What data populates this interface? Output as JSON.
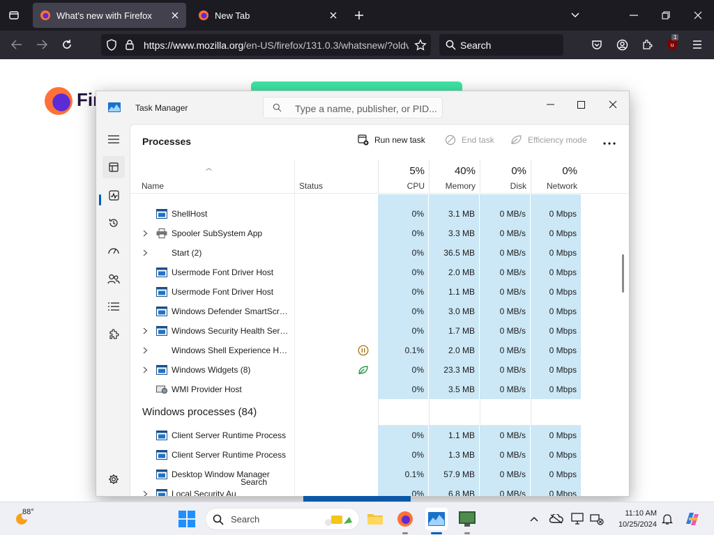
{
  "browser": {
    "tabs": [
      {
        "title": "What's new with Firefox",
        "active": true
      },
      {
        "title": "New Tab",
        "active": false
      }
    ],
    "url_host": "https://www.mozilla.org",
    "url_rest": "/en-US/firefox/131.0.3/whatsnew/?oldv",
    "search_placeholder": "Search",
    "extension_badge": "1",
    "page_brand": "Firef"
  },
  "task_manager": {
    "title": "Task Manager",
    "search_placeholder": "Type a name, publisher, or PID...",
    "page_title": "Processes",
    "actions": {
      "run_new_task": "Run new task",
      "end_task": "End task",
      "efficiency_mode": "Efficiency mode"
    },
    "columns": {
      "name": "Name",
      "status": "Status",
      "cpu_pct": "5%",
      "cpu": "CPU",
      "memory_pct": "40%",
      "memory": "Memory",
      "disk_pct": "0%",
      "disk": "Disk",
      "network_pct": "0%",
      "network": "Network"
    },
    "rows": [
      {
        "name": "ShellHost",
        "expandable": false,
        "icon": "window-icon",
        "cpu": "0%",
        "memory": "3.1 MB",
        "disk": "0 MB/s",
        "network": "0 Mbps"
      },
      {
        "name": "Spooler SubSystem App",
        "expandable": true,
        "icon": "printer-icon",
        "cpu": "0%",
        "memory": "3.3 MB",
        "disk": "0 MB/s",
        "network": "0 Mbps"
      },
      {
        "name": "Start (2)",
        "expandable": true,
        "icon": "none",
        "cpu": "0%",
        "memory": "36.5 MB",
        "disk": "0 MB/s",
        "network": "0 Mbps"
      },
      {
        "name": "Usermode Font Driver Host",
        "expandable": false,
        "icon": "window-icon",
        "cpu": "0%",
        "memory": "2.0 MB",
        "disk": "0 MB/s",
        "network": "0 Mbps"
      },
      {
        "name": "Usermode Font Driver Host",
        "expandable": false,
        "icon": "window-icon",
        "cpu": "0%",
        "memory": "1.1 MB",
        "disk": "0 MB/s",
        "network": "0 Mbps"
      },
      {
        "name": "Windows Defender SmartScreen",
        "expandable": false,
        "icon": "window-icon",
        "cpu": "0%",
        "memory": "3.0 MB",
        "disk": "0 MB/s",
        "network": "0 Mbps"
      },
      {
        "name": "Windows Security Health Servi...",
        "expandable": true,
        "icon": "window-icon",
        "cpu": "0%",
        "memory": "1.7 MB",
        "disk": "0 MB/s",
        "network": "0 Mbps"
      },
      {
        "name": "Windows Shell Experience Hos...",
        "expandable": true,
        "icon": "none",
        "status_icon": "suspended-icon",
        "cpu": "0.1%",
        "memory": "2.0 MB",
        "disk": "0 MB/s",
        "network": "0 Mbps"
      },
      {
        "name": "Windows Widgets (8)",
        "expandable": true,
        "icon": "window-icon",
        "status_icon": "efficiency-leaf-icon",
        "cpu": "0%",
        "memory": "23.3 MB",
        "disk": "0 MB/s",
        "network": "0 Mbps"
      },
      {
        "name": "WMI Provider Host",
        "expandable": false,
        "icon": "wmi-icon",
        "cpu": "0%",
        "memory": "3.5 MB",
        "disk": "0 MB/s",
        "network": "0 Mbps"
      }
    ],
    "group": {
      "label": "Windows processes (84)"
    },
    "group_rows": [
      {
        "name": "Client Server Runtime Process",
        "expandable": false,
        "icon": "window-icon",
        "cpu": "0%",
        "memory": "1.1 MB",
        "disk": "0 MB/s",
        "network": "0 Mbps"
      },
      {
        "name": "Client Server Runtime Process",
        "expandable": false,
        "icon": "window-icon",
        "cpu": "0%",
        "memory": "1.3 MB",
        "disk": "0 MB/s",
        "network": "0 Mbps"
      },
      {
        "name": "Desktop Window Manager",
        "expandable": false,
        "icon": "window-icon",
        "cpu": "0.1%",
        "memory": "57.9 MB",
        "disk": "0 MB/s",
        "network": "0 Mbps"
      },
      {
        "name": "Local Security Au",
        "expandable": true,
        "icon": "window-icon",
        "cpu": "0%",
        "memory": "6.8 MB",
        "disk": "0 MB/s",
        "network": "0 Mbps"
      }
    ],
    "tooltip": "Search"
  },
  "taskbar": {
    "temperature": "88°",
    "search_placeholder": "Search",
    "time": "11:10 AM",
    "date": "10/25/2024"
  },
  "colors": {
    "highlight": "#cce8f6",
    "accent": "#005fb8",
    "firefox_dark": "#1c1b22"
  }
}
